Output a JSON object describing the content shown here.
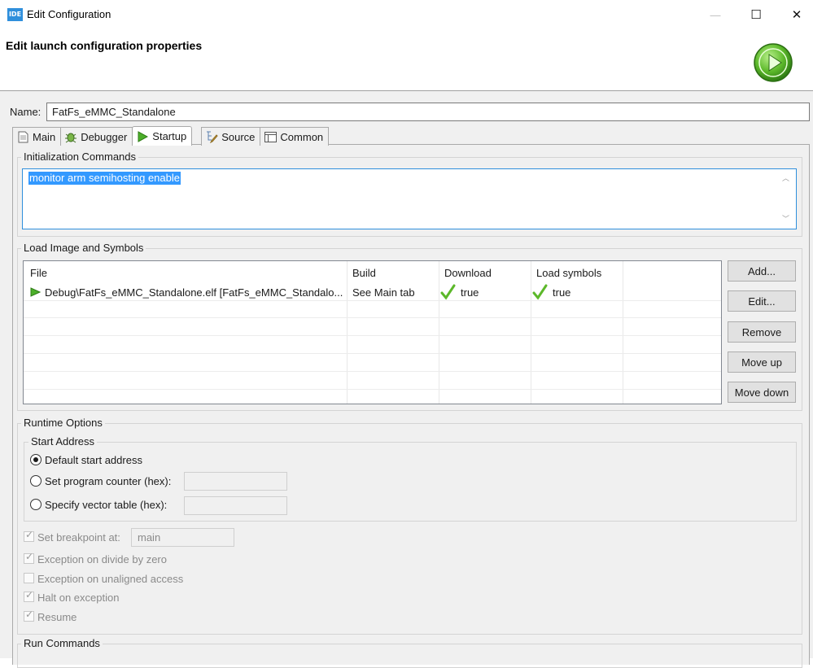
{
  "window": {
    "app_icon_text": "IDE",
    "title": "Edit Configuration",
    "min_glyph": "—",
    "max_glyph": "☐",
    "close_glyph": "✕"
  },
  "header": {
    "title": "Edit launch configuration properties",
    "icon": "run-launch-icon"
  },
  "name_field": {
    "label": "Name:",
    "value": "FatFs_eMMC_Standalone"
  },
  "tabs": [
    {
      "label": "Main",
      "icon": "document-icon"
    },
    {
      "label": "Debugger",
      "icon": "bug-icon"
    },
    {
      "label": "Startup",
      "icon": "play-icon",
      "active": true
    },
    {
      "label": "Source",
      "icon": "source-icon"
    },
    {
      "label": "Common",
      "icon": "common-icon"
    }
  ],
  "init_commands": {
    "group_title": "Initialization Commands",
    "value": "monitor arm semihosting enable"
  },
  "load_image": {
    "group_title": "Load Image and Symbols",
    "columns": [
      "File",
      "Build",
      "Download",
      "Load symbols"
    ],
    "rows": [
      {
        "file": "Debug\\FatFs_eMMC_Standalone.elf [FatFs_eMMC_Standalo...",
        "build": "See Main tab",
        "download": "true",
        "load_symbols": "true"
      }
    ],
    "buttons": [
      "Add...",
      "Edit...",
      "Remove",
      "Move up",
      "Move down"
    ]
  },
  "runtime_options": {
    "group_title": "Runtime Options",
    "start_address": {
      "title": "Start Address",
      "options": [
        {
          "label": "Default start address",
          "selected": true
        },
        {
          "label": "Set program counter (hex):",
          "selected": false
        },
        {
          "label": "Specify vector table (hex):",
          "selected": false
        }
      ]
    },
    "checks": [
      {
        "label": "Set breakpoint at:",
        "checked": true,
        "value": "main"
      },
      {
        "label": "Exception on divide by zero",
        "checked": true
      },
      {
        "label": "Exception on unaligned access",
        "checked": false
      },
      {
        "label": "Halt on exception",
        "checked": true
      },
      {
        "label": "Resume",
        "checked": true
      }
    ]
  },
  "run_commands": {
    "group_title": "Run Commands"
  },
  "colors": {
    "selection": "#3399ff",
    "accent": "#2f8fdc",
    "check_green": "#5cb82a"
  }
}
